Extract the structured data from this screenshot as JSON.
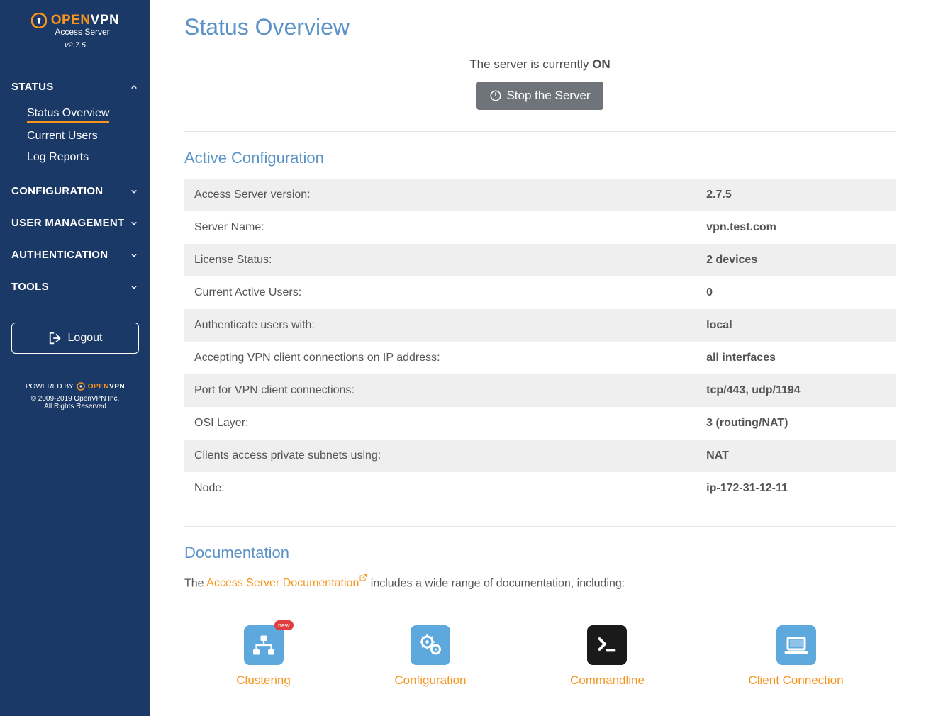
{
  "brand": {
    "open": "OPEN",
    "vpn": "VPN",
    "subtitle": "Access Server",
    "version": "v2.7.5"
  },
  "sidebar": {
    "sections": [
      {
        "label": "STATUS",
        "expanded": true,
        "items": [
          "Status Overview",
          "Current Users",
          "Log Reports"
        ]
      },
      {
        "label": "CONFIGURATION",
        "expanded": false
      },
      {
        "label": "USER  MANAGEMENT",
        "expanded": false
      },
      {
        "label": "AUTHENTICATION",
        "expanded": false
      },
      {
        "label": "TOOLS",
        "expanded": false
      }
    ],
    "logout": "Logout",
    "powered_by": "POWERED BY",
    "copyright": "© 2009-2019 OpenVPN Inc.",
    "rights": "All Rights Reserved"
  },
  "page": {
    "title": "Status Overview",
    "server_status_prefix": "The server is currently ",
    "server_status_value": "ON",
    "stop_btn": "Stop the Server"
  },
  "config": {
    "heading": "Active Configuration",
    "rows": [
      {
        "label": "Access Server version:",
        "value": "2.7.5"
      },
      {
        "label": "Server Name:",
        "value": "vpn.test.com"
      },
      {
        "label": "License Status:",
        "value": "2 devices"
      },
      {
        "label": "Current Active Users:",
        "value": "0"
      },
      {
        "label": "Authenticate users with:",
        "value": "local"
      },
      {
        "label": "Accepting VPN client connections on IP address:",
        "value": "all interfaces"
      },
      {
        "label": "Port for VPN client connections:",
        "value": "tcp/443, udp/1194"
      },
      {
        "label": "OSI Layer:",
        "value": "3 (routing/NAT)"
      },
      {
        "label": "Clients access private subnets using:",
        "value": "NAT"
      },
      {
        "label": "Node:",
        "value": "ip-172-31-12-11"
      }
    ]
  },
  "docs": {
    "heading": "Documentation",
    "intro_prefix": "The ",
    "link_text": "Access Server Documentation",
    "intro_suffix": " includes a wide range of documentation, including:",
    "cards": [
      {
        "caption": "Clustering",
        "badge": "new",
        "icon": "cluster"
      },
      {
        "caption": "Configuration",
        "icon": "gears"
      },
      {
        "caption": "Commandline",
        "icon": "terminal"
      },
      {
        "caption": "Client Connection",
        "icon": "laptop"
      }
    ]
  }
}
